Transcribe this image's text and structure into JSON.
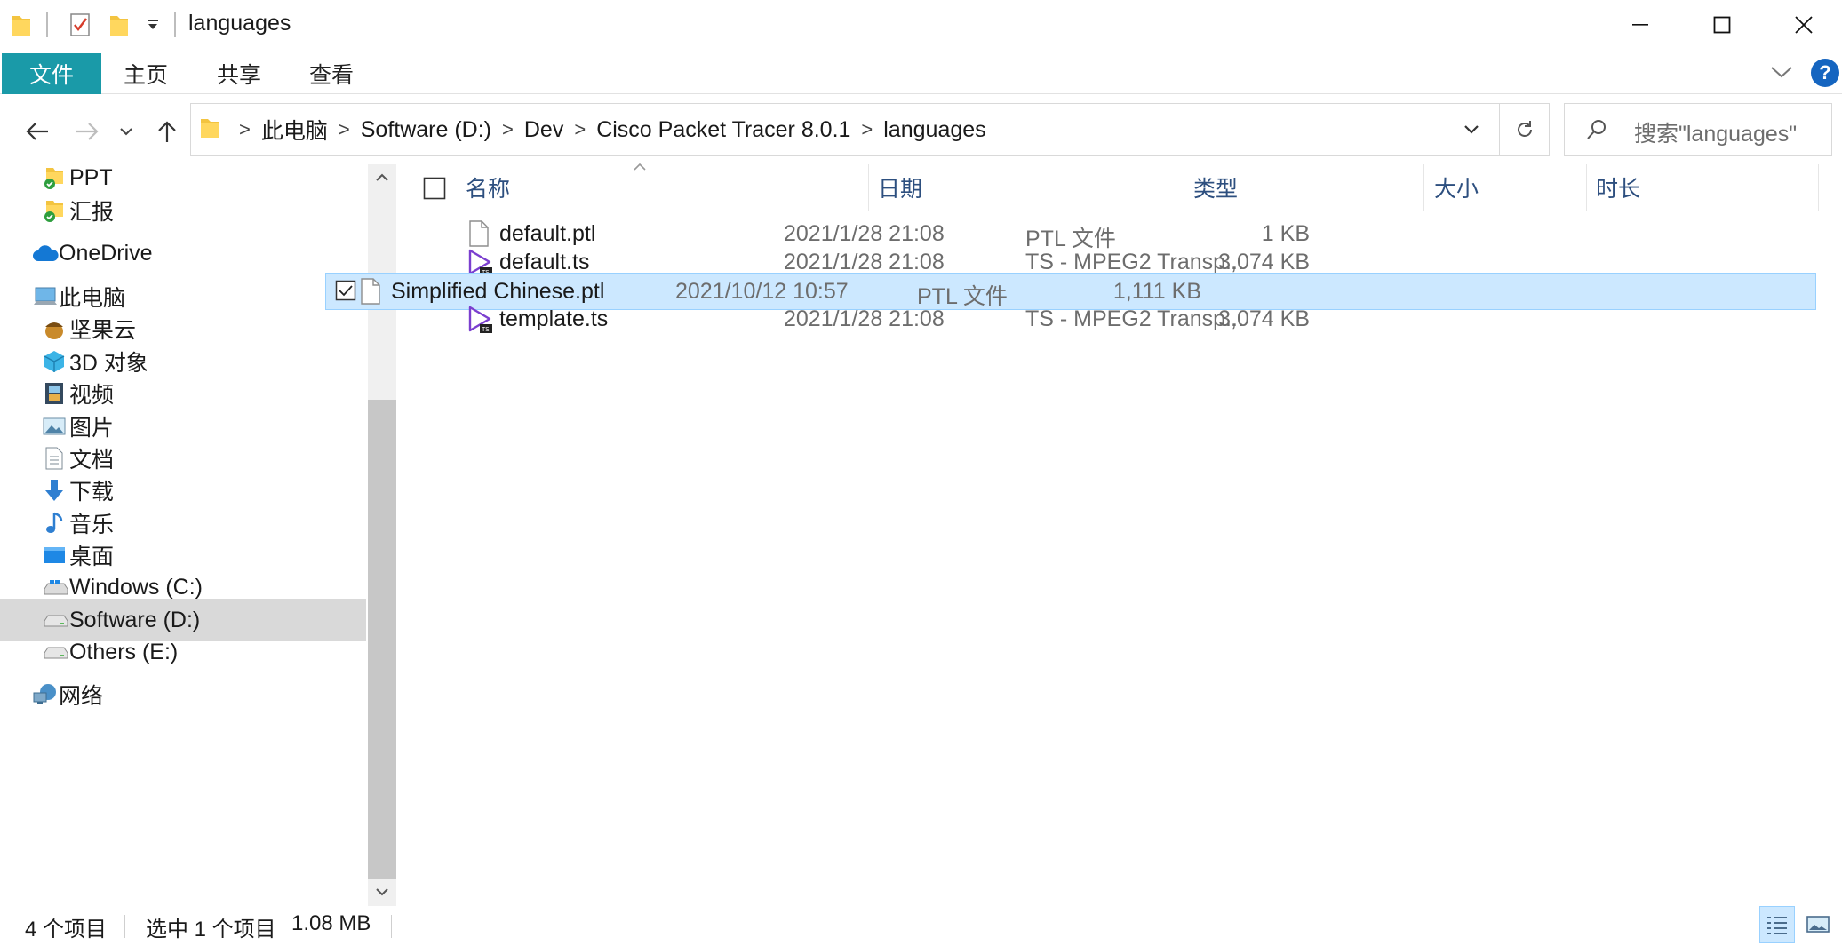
{
  "window": {
    "title": "languages"
  },
  "ribbon": {
    "tabs": [
      {
        "label": "文件"
      },
      {
        "label": "主页"
      },
      {
        "label": "共享"
      },
      {
        "label": "查看"
      }
    ],
    "help_label": "?"
  },
  "address": {
    "crumbs": [
      "此电脑",
      "Software (D:)",
      "Dev",
      "Cisco Packet Tracer 8.0.1",
      "languages"
    ],
    "separator": ">"
  },
  "search": {
    "placeholder": "搜索\"languages\""
  },
  "nav": {
    "items": [
      {
        "label": "PPT",
        "icon": "folder-sync-icon"
      },
      {
        "label": "汇报",
        "icon": "folder-sync-icon"
      },
      {
        "label": "OneDrive",
        "icon": "cloud-icon"
      },
      {
        "label": "此电脑",
        "icon": "computer-icon"
      },
      {
        "label": "坚果云",
        "icon": "nut-icon"
      },
      {
        "label": "3D 对象",
        "icon": "cube-icon"
      },
      {
        "label": "视频",
        "icon": "film-icon"
      },
      {
        "label": "图片",
        "icon": "picture-icon"
      },
      {
        "label": "文档",
        "icon": "document-icon"
      },
      {
        "label": "下载",
        "icon": "download-arrow-icon"
      },
      {
        "label": "音乐",
        "icon": "music-note-icon"
      },
      {
        "label": "桌面",
        "icon": "desktop-icon"
      },
      {
        "label": "Windows (C:)",
        "icon": "windows-drive-icon"
      },
      {
        "label": "Software (D:)",
        "icon": "drive-icon",
        "selected": true
      },
      {
        "label": "Others (E:)",
        "icon": "drive-icon"
      },
      {
        "label": "网络",
        "icon": "network-icon"
      }
    ]
  },
  "columns": {
    "name": "名称",
    "date": "日期",
    "type": "类型",
    "size": "大小",
    "duration": "时长"
  },
  "files": [
    {
      "name": "default.ptl",
      "date": "2021/1/28 21:08",
      "type": "PTL 文件",
      "size": "1 KB",
      "icon": "blank-file-icon",
      "selected": false
    },
    {
      "name": "default.ts",
      "date": "2021/1/28 21:08",
      "type": "TS - MPEG2 Transp...",
      "size": "3,074 KB",
      "icon": "ts-video-file-icon",
      "selected": false
    },
    {
      "name": "Simplified Chinese.ptl",
      "date": "2021/10/12 10:57",
      "type": "PTL 文件",
      "size": "1,111 KB",
      "icon": "blank-file-icon",
      "selected": true
    },
    {
      "name": "template.ts",
      "date": "2021/1/28 21:08",
      "type": "TS - MPEG2 Transp...",
      "size": "3,074 KB",
      "icon": "ts-video-file-icon",
      "selected": false
    }
  ],
  "status": {
    "count": "4 个项目",
    "selection": "选中 1 个项目",
    "selection_size": "1.08 MB"
  },
  "colors": {
    "file_tab": "#1a9aa8",
    "selected_row": "#cce8ff",
    "selected_nav": "#d9d9d9",
    "header_text": "#2d4f7f"
  }
}
